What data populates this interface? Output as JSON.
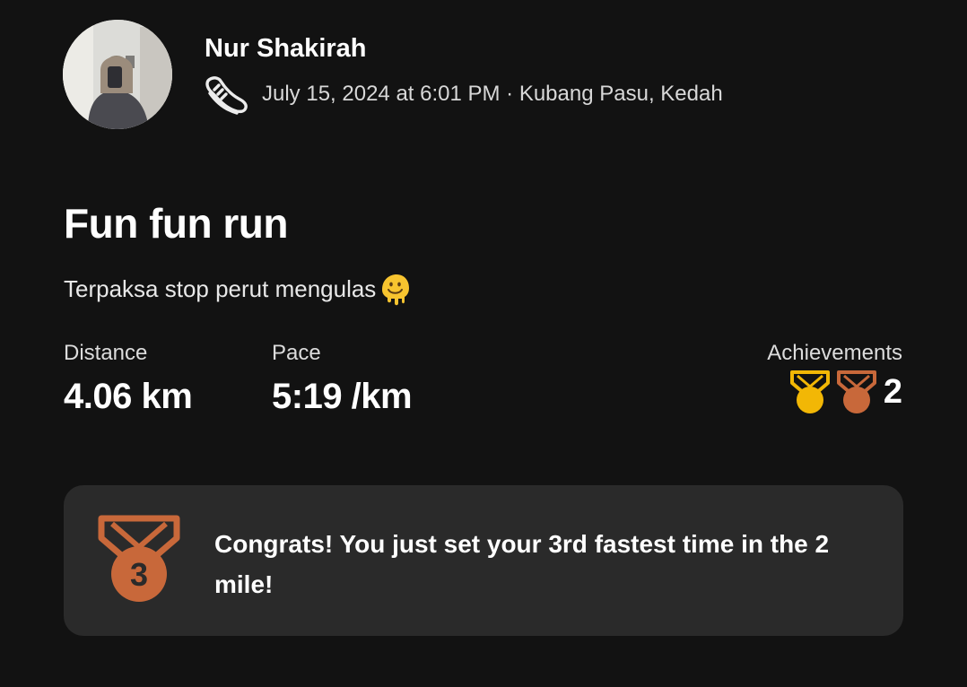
{
  "athlete": {
    "name": "Nur Shakirah",
    "avatar_icon": "profile-photo"
  },
  "activity": {
    "sport_icon": "running-shoe-icon",
    "meta": "July 15, 2024 at 6:01 PM · Kubang Pasu, Kedah",
    "title": "Fun fun run",
    "description": "Terpaksa stop perut mengulas",
    "description_emoji": "melting-face-emoji"
  },
  "stats": {
    "distance": {
      "label": "Distance",
      "value": "4.06 km"
    },
    "pace": {
      "label": "Pace",
      "value": "5:19 /km"
    },
    "achievements": {
      "label": "Achievements",
      "count": "2",
      "medals": [
        "gold-medal-icon",
        "bronze-medal-icon"
      ]
    }
  },
  "congrats": {
    "medal_number": "3",
    "message": "Congrats! You just set your 3rd fastest time in the 2 mile!"
  },
  "colors": {
    "background": "#121212",
    "card": "#2a2a2a",
    "gold": "#F2B705",
    "bronze": "#C8683A"
  }
}
